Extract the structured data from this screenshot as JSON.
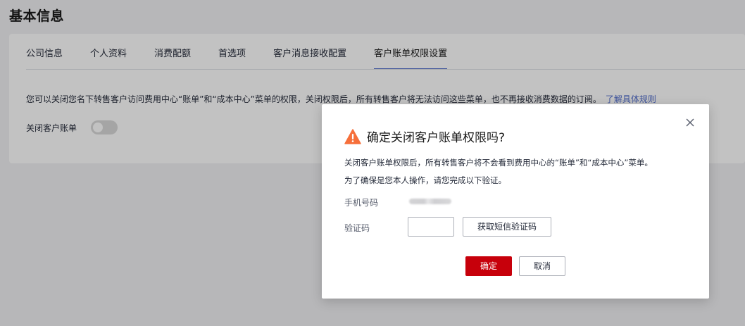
{
  "page": {
    "title": "基本信息"
  },
  "tabs": [
    {
      "label": "公司信息"
    },
    {
      "label": "个人资料"
    },
    {
      "label": "消费配额"
    },
    {
      "label": "首选项"
    },
    {
      "label": "客户消息接收配置"
    },
    {
      "label": "客户账单权限设置",
      "active": true
    }
  ],
  "content": {
    "description": "您可以关闭您名下转售客户访问费用中心“账单”和“成本中心”菜单的权限，关闭权限后，所有转售客户将无法访问这些菜单，也不再接收消费数据的订阅。",
    "rules_link": "了解具体规则",
    "toggle_label": "关闭客户账单",
    "toggle_on": false
  },
  "dialog": {
    "title": "确定关闭客户账单权限吗?",
    "line1": "关闭客户账单权限后，所有转售客户将不会看到费用中心的“账单”和“成本中心”菜单。",
    "line2": "为了确保是您本人操作，请您完成以下验证。",
    "phone_label": "手机号码",
    "code_label": "验证码",
    "code_value": "",
    "sms_button": "获取短信验证码",
    "confirm_button": "确定",
    "cancel_button": "取消",
    "warning_color": "#f66f3a",
    "confirm_color": "#c7000b"
  }
}
